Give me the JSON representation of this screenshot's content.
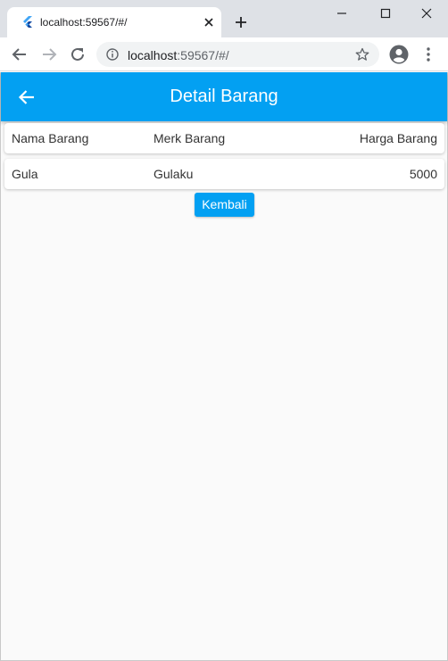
{
  "browser": {
    "tab_title": "localhost:59567/#/",
    "url_host": "localhost",
    "url_rest": ":59567/#/",
    "favicon": "flutter-logo-icon",
    "icons": [
      "back-arrow-icon",
      "forward-arrow-icon",
      "reload-icon",
      "info-icon",
      "star-icon",
      "profile-icon",
      "kebab-menu-icon"
    ]
  },
  "app": {
    "title": "Detail Barang",
    "header_row": {
      "nama": "Nama Barang",
      "merk": "Merk Barang",
      "harga": "Harga Barang"
    },
    "item_row": {
      "nama": "Gula",
      "merk": "Gulaku",
      "harga": "5000"
    },
    "back_button_label": "Kembali",
    "colors": {
      "primary": "#03a0f2",
      "background": "#fafafa",
      "text": "#333333"
    }
  }
}
